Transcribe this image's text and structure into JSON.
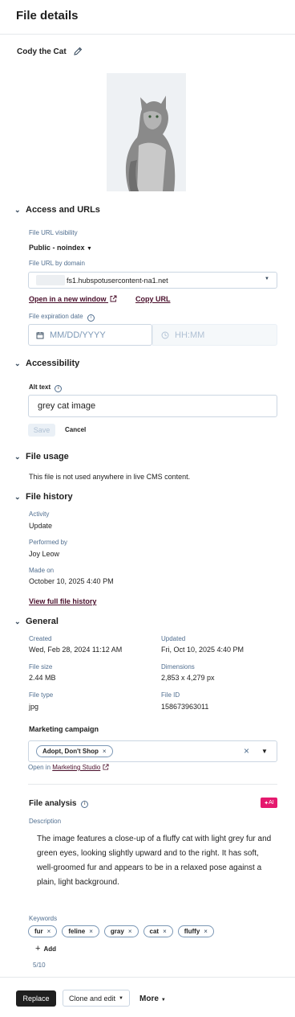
{
  "header": {
    "title": "File details"
  },
  "file": {
    "name": "Cody the Cat"
  },
  "access": {
    "section_title": "Access and URLs",
    "visibility_label": "File URL visibility",
    "visibility_value": "Public - noindex",
    "url_label": "File URL by domain",
    "url_value": "fs1.hubspotusercontent-na1.net",
    "open_link": "Open in a new window",
    "copy_link": "Copy URL",
    "expiration_label": "File expiration date",
    "date_placeholder": "MM/DD/YYYY",
    "time_placeholder": "HH:MM"
  },
  "accessibility": {
    "section_title": "Accessibility",
    "alt_label": "Alt text",
    "alt_value": "grey cat image",
    "save": "Save",
    "cancel": "Cancel"
  },
  "usage": {
    "section_title": "File usage",
    "text": "This file is not used anywhere in live CMS content."
  },
  "history": {
    "section_title": "File history",
    "activity_label": "Activity",
    "activity_value": "Update",
    "performed_label": "Performed by",
    "performed_value": "Joy Leow",
    "made_label": "Made on",
    "made_value": "October 10, 2025 4:40 PM",
    "full_link": "View full file history"
  },
  "general": {
    "section_title": "General",
    "created_label": "Created",
    "created_value": "Wed, Feb 28, 2024 11:12 AM",
    "updated_label": "Updated",
    "updated_value": "Fri, Oct 10, 2025 4:40 PM",
    "size_label": "File size",
    "size_value": "2.44 MB",
    "dim_label": "Dimensions",
    "dim_value": "2,853 x 4,279 px",
    "type_label": "File type",
    "type_value": "jpg",
    "id_label": "File ID",
    "id_value": "158673963011",
    "campaign_label": "Marketing campaign",
    "campaign_value": "Adopt, Don't Shop",
    "open_in": "Open in",
    "studio_link": "Marketing Studio"
  },
  "analysis": {
    "title": "File analysis",
    "ai_badge": "AI",
    "description_label": "Description",
    "description": "The image features a close-up of a fluffy cat with light grey fur and green eyes, looking slightly upward and to the right. It has soft, well-groomed fur and appears to be in a relaxed pose against a plain, light background.",
    "keywords_label": "Keywords",
    "keywords": [
      "fur",
      "feline",
      "gray",
      "cat",
      "fluffy"
    ],
    "add": "Add",
    "count": "5/10"
  },
  "footer": {
    "replace": "Replace",
    "clone": "Clone and edit",
    "more": "More"
  },
  "colors": {
    "footer_dark": "#1f1f1f",
    "link": "#4a0f2b",
    "ai_badge": "#e5196e",
    "border": "#cbd6e2"
  }
}
